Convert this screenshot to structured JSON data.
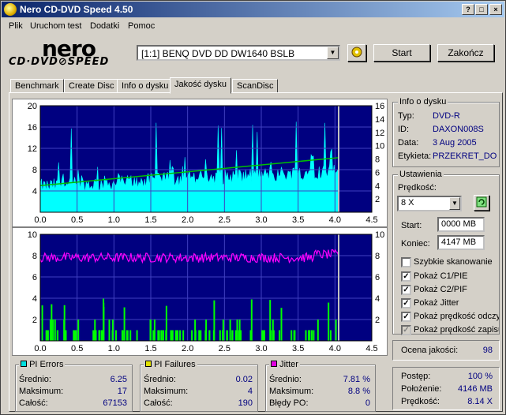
{
  "window": {
    "title": "Nero CD-DVD Speed 4.50",
    "controls": [
      "?",
      "□",
      "×"
    ]
  },
  "menu": [
    "Plik",
    "Uruchom test",
    "Dodatki",
    "Pomoc"
  ],
  "logo": {
    "line1": "nero",
    "line2": "CD·DVD⊘SPEED"
  },
  "drive": {
    "selected": "[1:1]  BENQ DVD DD DW1640 BSLB"
  },
  "buttons": {
    "start": "Start",
    "end": "Zakończ"
  },
  "tabs": [
    {
      "label": "Benchmark",
      "active": false
    },
    {
      "label": "Create Disc",
      "active": false
    },
    {
      "label": "Info o dysku",
      "active": false
    },
    {
      "label": "Jakość dysku",
      "active": true
    },
    {
      "label": "ScanDisc",
      "active": false
    }
  ],
  "disc_info": {
    "title": "Info o dysku",
    "rows": [
      {
        "label": "Typ:",
        "value": "DVD-R"
      },
      {
        "label": "ID:",
        "value": "DAXON008S"
      },
      {
        "label": "Data:",
        "value": "3 Aug 2005"
      },
      {
        "label": "Etykieta:",
        "value": "PRZEKRET_DO"
      }
    ]
  },
  "settings": {
    "title": "Ustawienia",
    "speed_label": "Prędkość:",
    "speed_value": "8 X",
    "start_label": "Start:",
    "start_value": "0000 MB",
    "end_label": "Koniec:",
    "end_value": "4147 MB",
    "checks": [
      {
        "label": "Szybkie skanowanie",
        "checked": false,
        "disabled": false
      },
      {
        "label": "Pokaż C1/PIE",
        "checked": true,
        "disabled": false
      },
      {
        "label": "Pokaż C2/PIF",
        "checked": true,
        "disabled": false
      },
      {
        "label": "Pokaż Jitter",
        "checked": true,
        "disabled": false
      },
      {
        "label": "Pokaż prędkość odczytu",
        "checked": true,
        "disabled": false
      },
      {
        "label": "Pokaż prędkość zapisu",
        "checked": true,
        "disabled": true
      }
    ]
  },
  "quality": {
    "label": "Ocena jakości:",
    "value": "98"
  },
  "progress": {
    "rows": [
      {
        "label": "Postęp:",
        "value": "100 %"
      },
      {
        "label": "Położenie:",
        "value": "4146 MB"
      },
      {
        "label": "Prędkość:",
        "value": "8.14 X"
      }
    ]
  },
  "pi_errors": {
    "title": "PI Errors",
    "color": "#00e0e0",
    "rows": [
      {
        "label": "Średnio:",
        "value": "6.25"
      },
      {
        "label": "Maksimum:",
        "value": "17"
      },
      {
        "label": "Całość:",
        "value": "67153"
      }
    ]
  },
  "pi_failures": {
    "title": "PI Failures",
    "color": "#e0e000",
    "rows": [
      {
        "label": "Średnio:",
        "value": "0.02"
      },
      {
        "label": "Maksimum:",
        "value": "4"
      },
      {
        "label": "Całość:",
        "value": "190"
      }
    ]
  },
  "jitter": {
    "title": "Jitter",
    "color": "#e000e0",
    "rows": [
      {
        "label": "Średnio:",
        "value": "7.81 %"
      },
      {
        "label": "Maksimum:",
        "value": "8.8 %"
      },
      {
        "label": "Błędy PO:",
        "value": "0"
      }
    ]
  },
  "chart_data": [
    {
      "type": "area",
      "series": [
        {
          "name": "PI Errors",
          "color": "#00ffff"
        },
        {
          "name": "Read speed",
          "color": "#00c000"
        }
      ],
      "x_ticks": [
        "0.0",
        "0.5",
        "1.0",
        "1.5",
        "2.0",
        "2.5",
        "3.0",
        "3.5",
        "4.0",
        "4.5"
      ],
      "y_left_ticks": [
        "20",
        "16",
        "12",
        "8",
        "4"
      ],
      "y_right_ticks": [
        "16",
        "14",
        "12",
        "10",
        "8",
        "6",
        "4",
        "2"
      ],
      "xlim": [
        0,
        4.5
      ],
      "ylim_left": [
        0,
        20
      ],
      "ylim_right": [
        0,
        16
      ],
      "x_end": 4.05,
      "pi_mean": 6.25,
      "pi_max": 17,
      "speed_start": 4,
      "speed_end": 8.2,
      "grid": true,
      "background": "#000080"
    },
    {
      "type": "bar",
      "series": [
        {
          "name": "PI Failures",
          "color": "#00ff00"
        },
        {
          "name": "Jitter",
          "color": "#ff00ff"
        }
      ],
      "x_ticks": [
        "0.0",
        "0.5",
        "1.0",
        "1.5",
        "2.0",
        "2.5",
        "3.0",
        "3.5",
        "4.0",
        "4.5"
      ],
      "y_left_ticks": [
        "10",
        "8",
        "6",
        "4",
        "2"
      ],
      "y_right_ticks": [
        "10",
        "8",
        "6",
        "4",
        "2"
      ],
      "xlim": [
        0,
        4.5
      ],
      "ylim_left": [
        0,
        10
      ],
      "ylim_right": [
        0,
        10
      ],
      "x_end": 4.05,
      "jitter_mean": 7.81,
      "pif_max": 4,
      "grid": true,
      "background": "#000080"
    }
  ]
}
